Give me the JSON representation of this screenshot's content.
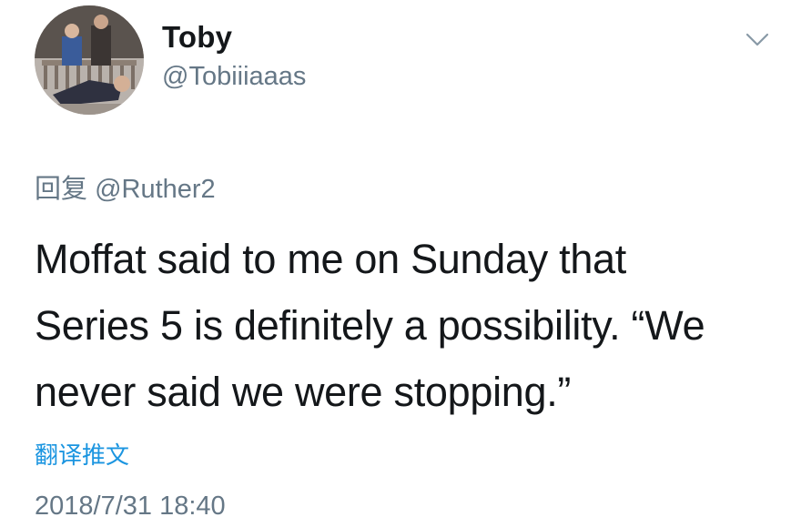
{
  "author": {
    "display_name": "Toby",
    "handle": "@Tobiiiaaas",
    "avatar_icon": "user-avatar-photo"
  },
  "menu": {
    "icon": "chevron-down-icon"
  },
  "reply": {
    "prefix": "回复",
    "mention": "@Ruther2"
  },
  "tweet": {
    "lines": [
      "Moffat said to me on Sunday that",
      "Series 5 is definitely a possibility. “We",
      "never said we were stopping.”"
    ]
  },
  "translate_label": "翻译推文",
  "timestamp": "2018/7/31 18:40",
  "colors": {
    "text": "#14171a",
    "secondary": "#657786",
    "link": "#1b95e0",
    "background": "#ffffff"
  }
}
